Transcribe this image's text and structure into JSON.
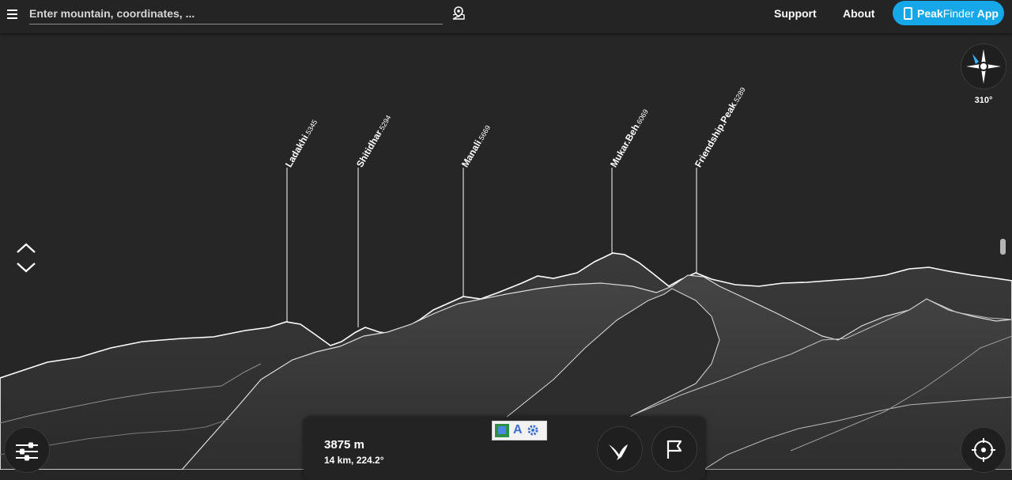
{
  "topbar": {
    "search_placeholder": "Enter mountain, coordinates, ...",
    "support_label": "Support",
    "about_label": "About",
    "app_button_bold": "Peak",
    "app_button_thin": "Finder",
    "app_button_suffix": " App",
    "accent_color": "#15a7e8"
  },
  "peaks": [
    {
      "name": "Ladakhi",
      "elevation": "5345"
    },
    {
      "name": "Shitidhar",
      "elevation": "5294"
    },
    {
      "name": "Manali",
      "elevation": "5669"
    },
    {
      "name": "Mukar.Beh",
      "elevation": "6069"
    },
    {
      "name": "Friendship.Peak",
      "elevation": "5289"
    }
  ],
  "compass": {
    "heading": "310°"
  },
  "info_panel": {
    "altitude": "3875 m",
    "distance_bearing": "14 km, 224.2°"
  },
  "icons": {
    "menu": "menu-icon",
    "pin": "map-pin-icon",
    "app": "phone-icon",
    "compass": "compass-icon",
    "updown": "chevron-up-down-icon",
    "settings": "sliders-icon",
    "bird": "bird-icon",
    "flag": "flag-icon",
    "locate": "crosshair-icon"
  }
}
